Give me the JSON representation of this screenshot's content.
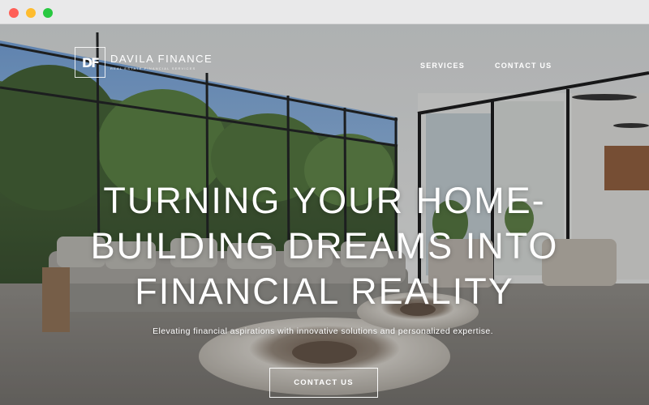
{
  "brand": {
    "mark": "DF",
    "name": "DAVILA FINANCE",
    "tagline": "REAL ESTATE FINANCIAL SERVICES"
  },
  "nav": {
    "items": [
      {
        "label": "SERVICES"
      },
      {
        "label": "CONTACT US"
      }
    ]
  },
  "hero": {
    "headline_lines": [
      "TURNING YOUR HOME-",
      "BUILDING DREAMS INTO",
      "FINANCIAL REALITY"
    ],
    "subheadline": "Elevating financial aspirations with innovative solutions and personalized expertise.",
    "cta_label": "CONTACT US"
  },
  "window_controls": [
    "close",
    "minimize",
    "maximize"
  ],
  "colors": {
    "text": "#ffffff",
    "close": "#ff5f57",
    "minimize": "#febc2e",
    "maximize": "#28c840"
  }
}
